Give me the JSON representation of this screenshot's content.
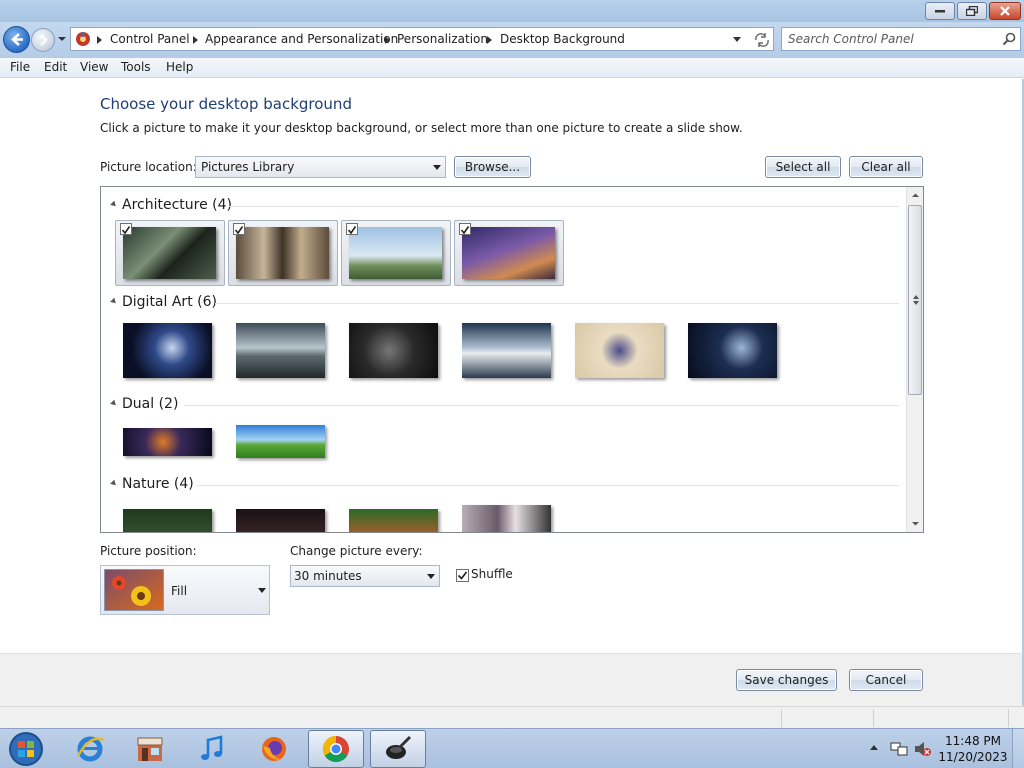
{
  "window": {
    "minimize_icon": "minimize-icon",
    "maximize_icon": "restore-icon",
    "close_icon": "close-icon"
  },
  "address": {
    "crumbs": [
      "Control Panel",
      "Appearance and Personalization",
      "Personalization",
      "Desktop Background"
    ],
    "search_placeholder": "Search Control Panel"
  },
  "menu": [
    "File",
    "Edit",
    "View",
    "Tools",
    "Help"
  ],
  "page": {
    "title": "Choose your desktop background",
    "subtitle": "Click a picture to make it your desktop background, or select more than one picture to create a slide show.",
    "location_label": "Picture location:",
    "location_value": "Pictures Library",
    "browse": "Browse...",
    "select_all": "Select all",
    "clear_all": "Clear all"
  },
  "groups": [
    {
      "title": "Architecture (4)",
      "count": 4,
      "checked": true
    },
    {
      "title": "Digital Art (6)",
      "count": 6,
      "checked": false
    },
    {
      "title": "Dual (2)",
      "count": 2,
      "checked": false
    },
    {
      "title": "Nature (4)",
      "count": 4,
      "checked": false
    }
  ],
  "options": {
    "position_label": "Picture position:",
    "position_value": "Fill",
    "interval_label": "Change picture every:",
    "interval_value": "30 minutes",
    "shuffle_label": "Shuffle",
    "shuffle_checked": true
  },
  "footer": {
    "save": "Save changes",
    "cancel": "Cancel"
  },
  "taskbar": {
    "apps": [
      "start-orb",
      "internet-explorer-icon",
      "store-icon",
      "music-icon",
      "firefox-icon",
      "chrome-icon",
      "paint-icon"
    ],
    "time": "11:48 PM",
    "date": "11/20/2023"
  }
}
